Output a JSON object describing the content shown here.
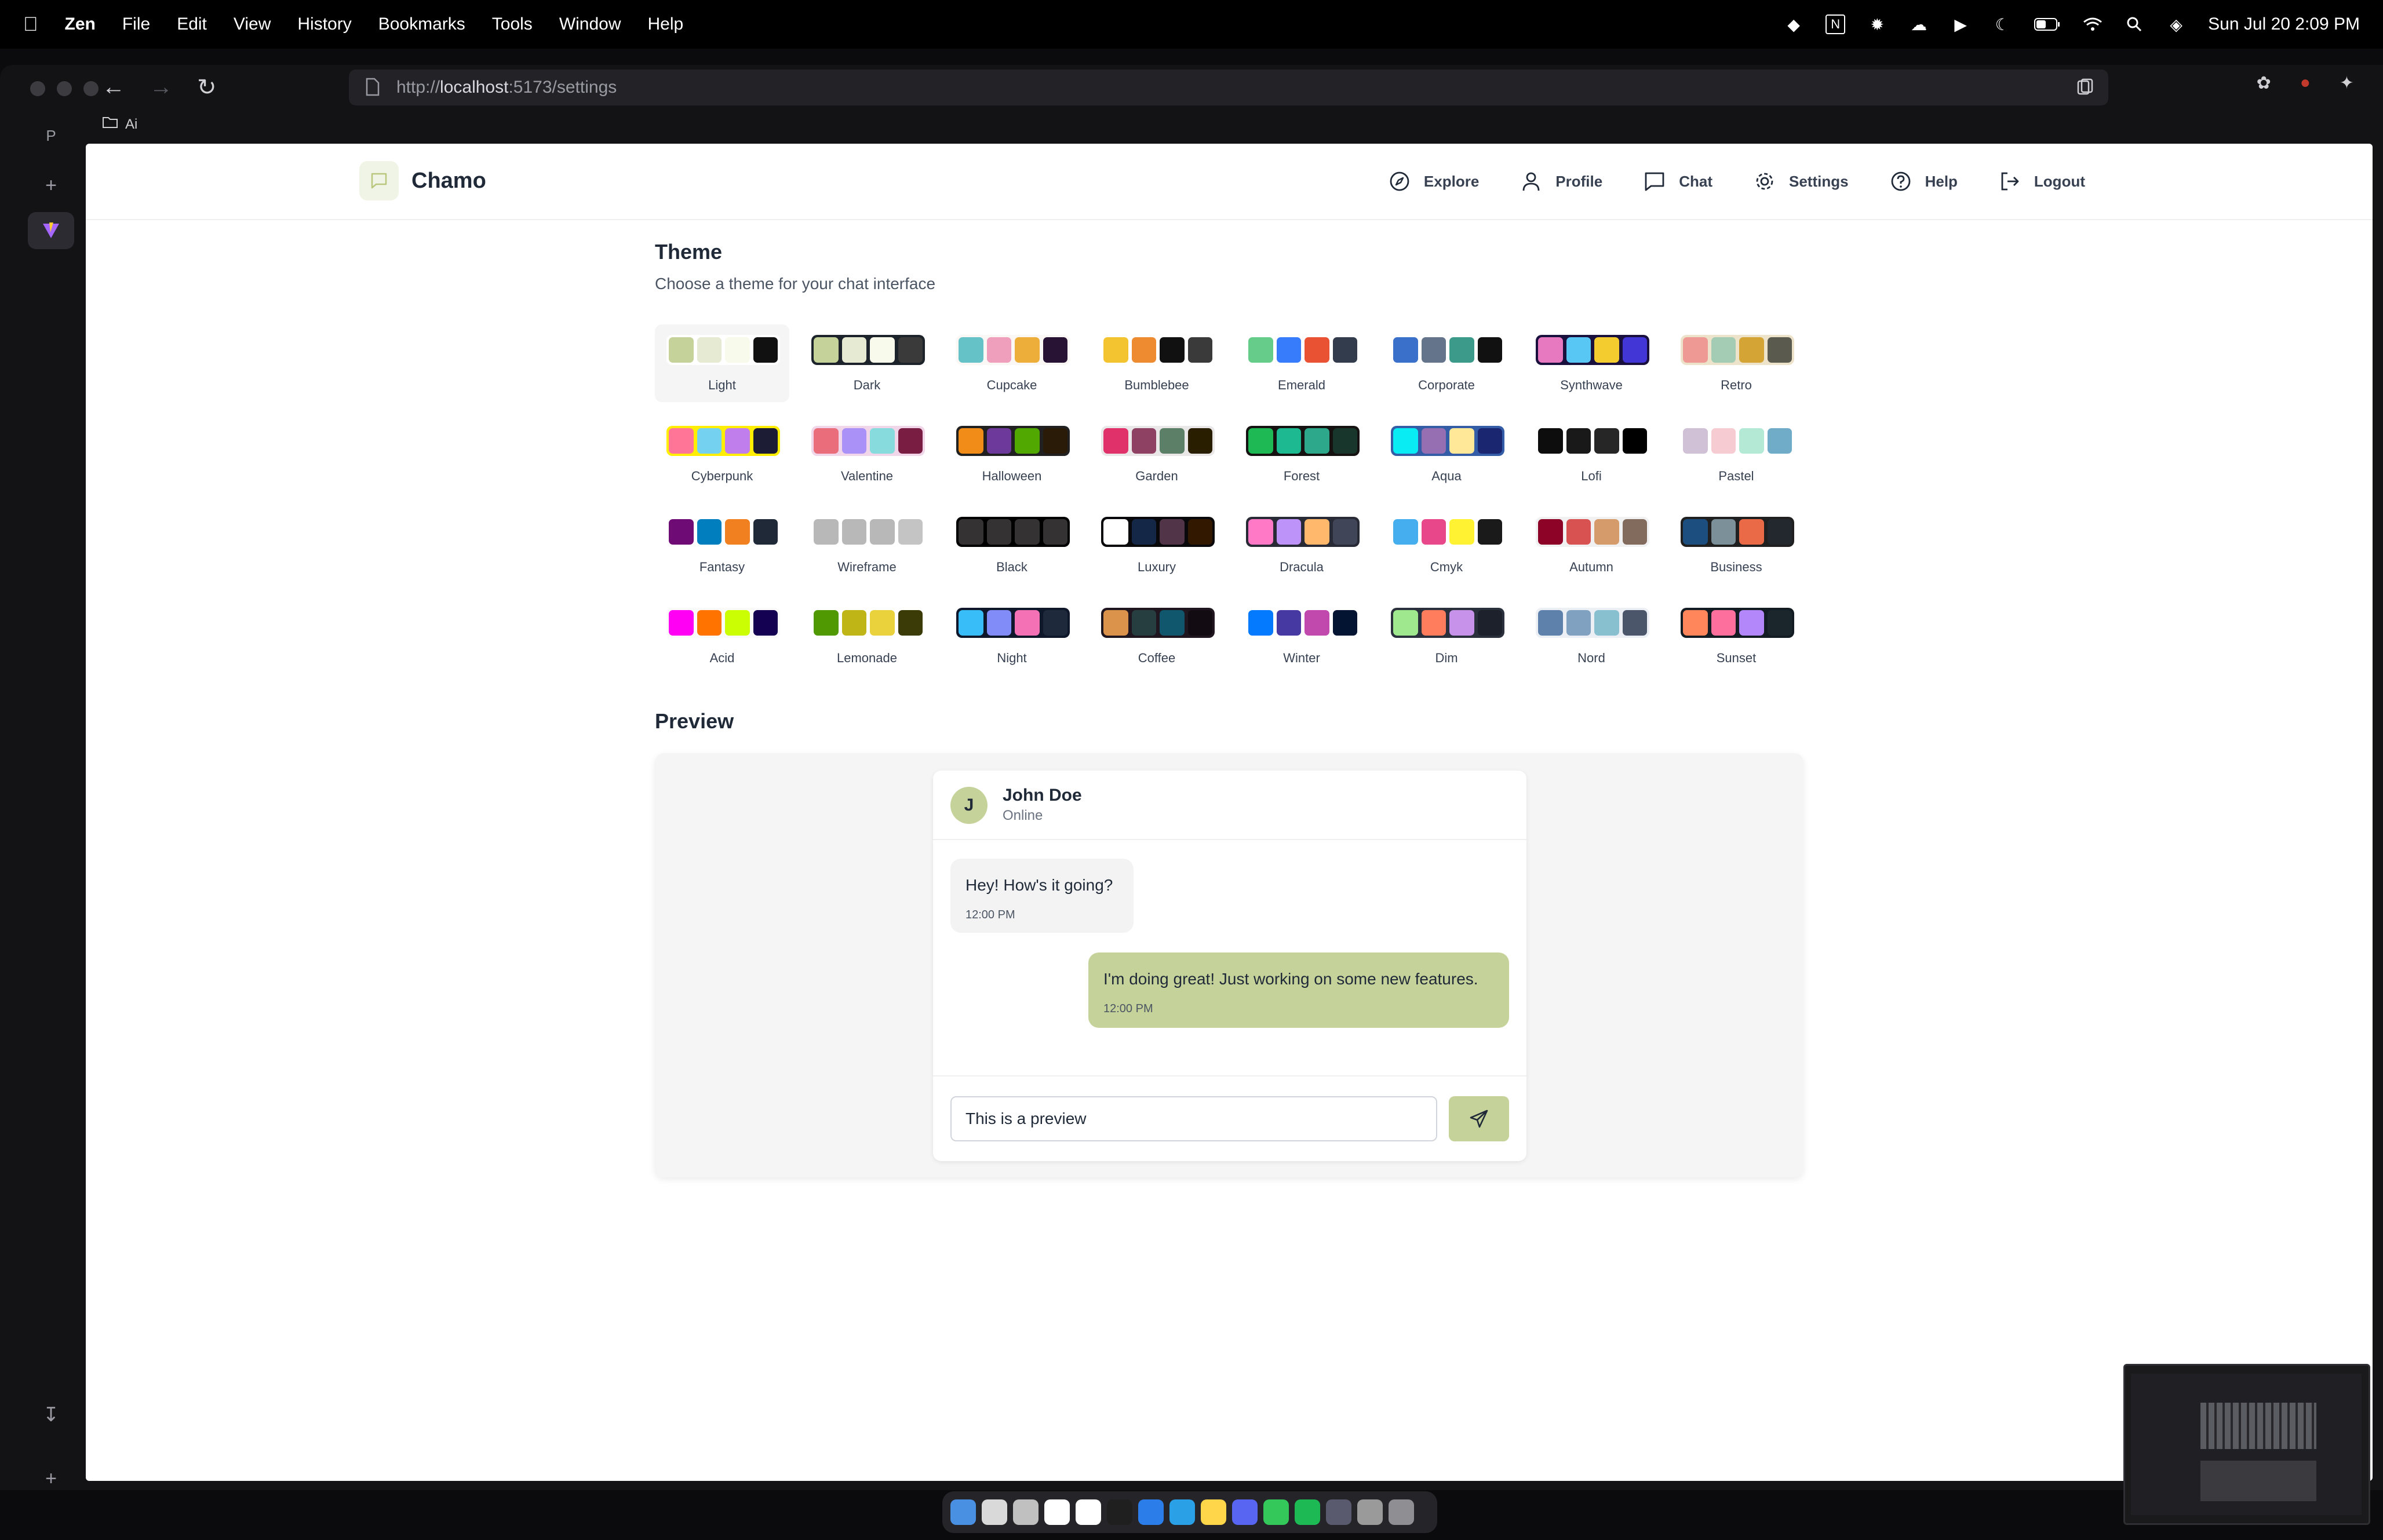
{
  "menubar": {
    "app": "Zen",
    "items": [
      "File",
      "Edit",
      "View",
      "History",
      "Bookmarks",
      "Tools",
      "Window",
      "Help"
    ],
    "clock": "Sun Jul 20  2:09 PM"
  },
  "browser": {
    "url_prefix": "http://",
    "url_host": "localhost",
    "url_path": ":5173/settings",
    "bookmark_folder": "Ai",
    "workspace_letter": "P"
  },
  "app": {
    "brand": "Chamo",
    "nav": [
      {
        "label": "Explore",
        "icon": "compass-icon"
      },
      {
        "label": "Profile",
        "icon": "user-icon"
      },
      {
        "label": "Chat",
        "icon": "chat-bubble-icon"
      },
      {
        "label": "Settings",
        "icon": "gear-icon"
      },
      {
        "label": "Help",
        "icon": "help-circle-icon"
      },
      {
        "label": "Logout",
        "icon": "logout-icon"
      }
    ]
  },
  "theme_section": {
    "title": "Theme",
    "subtitle": "Choose a theme for your chat interface",
    "selected": "Light",
    "themes": [
      {
        "name": "Light",
        "frame": "#ffffff",
        "colors": [
          "#c5d29a",
          "#e6ead3",
          "#f8fbec",
          "#111111"
        ]
      },
      {
        "name": "Dark",
        "frame": "#1d232a",
        "colors": [
          "#c5d29a",
          "#e6ead3",
          "#f8fbec",
          "#3a3a3a"
        ]
      },
      {
        "name": "Cupcake",
        "frame": "#faf7f5",
        "colors": [
          "#65c3c8",
          "#ef9fbc",
          "#eeaf3a",
          "#291334"
        ]
      },
      {
        "name": "Bumblebee",
        "frame": "#ffffff",
        "colors": [
          "#f4c430",
          "#ee8a2f",
          "#111111",
          "#3a3a3a"
        ]
      },
      {
        "name": "Emerald",
        "frame": "#ffffff",
        "colors": [
          "#66cc8a",
          "#377cfb",
          "#ea5234",
          "#333c4d"
        ]
      },
      {
        "name": "Corporate",
        "frame": "#ffffff",
        "colors": [
          "#3a70c9",
          "#64748b",
          "#3b9a8a",
          "#111111"
        ]
      },
      {
        "name": "Synthwave",
        "frame": "#1a103d",
        "colors": [
          "#e779c1",
          "#58c7f3",
          "#f3cc30",
          "#4336d6"
        ]
      },
      {
        "name": "Retro",
        "frame": "#ece3ca",
        "colors": [
          "#ef9995",
          "#a4cbb4",
          "#d4a535",
          "#5b5a4f"
        ]
      },
      {
        "name": "Cyberpunk",
        "frame": "#ffee00",
        "colors": [
          "#ff7598",
          "#75d1f0",
          "#c07eec",
          "#1c1d35"
        ]
      },
      {
        "name": "Valentine",
        "frame": "#f0d6e8",
        "colors": [
          "#e96d7b",
          "#a991f7",
          "#88dbdd",
          "#7a1d42"
        ]
      },
      {
        "name": "Halloween",
        "frame": "#212121",
        "colors": [
          "#f28c18",
          "#6d3a9c",
          "#51a800",
          "#2a1a08"
        ]
      },
      {
        "name": "Garden",
        "frame": "#e9e7e7",
        "colors": [
          "#e0316a",
          "#8e4162",
          "#5c7f67",
          "#291e00"
        ]
      },
      {
        "name": "Forest",
        "frame": "#171212",
        "colors": [
          "#1eb854",
          "#1db990",
          "#2ea88a",
          "#19362d"
        ]
      },
      {
        "name": "Aqua",
        "frame": "#345da7",
        "colors": [
          "#09ecf3",
          "#966fb3",
          "#ffe999",
          "#1b2670"
        ]
      },
      {
        "name": "Lofi",
        "frame": "#ffffff",
        "colors": [
          "#0d0d0d",
          "#1a1919",
          "#262626",
          "#000000"
        ]
      },
      {
        "name": "Pastel",
        "frame": "#ffffff",
        "colors": [
          "#d1c1d7",
          "#f6cbd1",
          "#b4e9d6",
          "#70acc7"
        ]
      },
      {
        "name": "Fantasy",
        "frame": "#ffffff",
        "colors": [
          "#6e0b75",
          "#007ebd",
          "#f18021",
          "#1f2937"
        ]
      },
      {
        "name": "Wireframe",
        "frame": "#ffffff",
        "colors": [
          "#b8b8b8",
          "#b8b8b8",
          "#b8b8b8",
          "#c4c4c4"
        ]
      },
      {
        "name": "Black",
        "frame": "#000000",
        "colors": [
          "#343232",
          "#343232",
          "#343232",
          "#343232"
        ]
      },
      {
        "name": "Luxury",
        "frame": "#09090b",
        "colors": [
          "#ffffff",
          "#152747",
          "#513448",
          "#331800"
        ]
      },
      {
        "name": "Dracula",
        "frame": "#282a36",
        "colors": [
          "#ff79c6",
          "#bd93f9",
          "#ffb86c",
          "#414558"
        ]
      },
      {
        "name": "Cmyk",
        "frame": "#ffffff",
        "colors": [
          "#45aeee",
          "#e8488a",
          "#fff232",
          "#1a1a1a"
        ]
      },
      {
        "name": "Autumn",
        "frame": "#f1f1f1",
        "colors": [
          "#8c0327",
          "#d85251",
          "#d59b6a",
          "#826a5c"
        ]
      },
      {
        "name": "Business",
        "frame": "#202020",
        "colors": [
          "#1c4e80",
          "#7c909a",
          "#ea6947",
          "#23282e"
        ]
      },
      {
        "name": "Acid",
        "frame": "#fafafa",
        "colors": [
          "#ff00f4",
          "#ff7400",
          "#cbfd03",
          "#140152"
        ]
      },
      {
        "name": "Lemonade",
        "frame": "#ffffff",
        "colors": [
          "#519903",
          "#c0b516",
          "#e9d23b",
          "#3a3b06"
        ]
      },
      {
        "name": "Night",
        "frame": "#0f172a",
        "colors": [
          "#38bdf8",
          "#818cf8",
          "#f471b5",
          "#1e293b"
        ]
      },
      {
        "name": "Coffee",
        "frame": "#20161f",
        "colors": [
          "#db924b",
          "#263e3f",
          "#10576d",
          "#120c12"
        ]
      },
      {
        "name": "Winter",
        "frame": "#ffffff",
        "colors": [
          "#047aff",
          "#463aa2",
          "#c148ac",
          "#021431"
        ]
      },
      {
        "name": "Dim",
        "frame": "#2a303c",
        "colors": [
          "#9fe88d",
          "#ff7d5c",
          "#c792e9",
          "#1c212b"
        ]
      },
      {
        "name": "Nord",
        "frame": "#eceff4",
        "colors": [
          "#5e81ac",
          "#81a1c1",
          "#88c0d0",
          "#4c566a"
        ]
      },
      {
        "name": "Sunset",
        "frame": "#121c22",
        "colors": [
          "#ff865b",
          "#fd6f9c",
          "#b387fa",
          "#1b262c"
        ]
      }
    ]
  },
  "preview_section": {
    "title": "Preview",
    "contact": {
      "initial": "J",
      "name": "John Doe",
      "status": "Online"
    },
    "messages": [
      {
        "text": "Hey! How's it going?",
        "time": "12:00 PM",
        "from": "them"
      },
      {
        "text": "I'm doing great! Just working on some new features.",
        "time": "12:00 PM",
        "from": "me"
      }
    ],
    "input_value": "This is a preview"
  },
  "colors": {
    "accent": "#c5d29a",
    "accent_light": "#f0f4e6"
  },
  "dock": {
    "app_colors": [
      "#4a90e2",
      "#d9d9d9",
      "#c0c0c0",
      "#ffffff",
      "#ffffff",
      "#1f1f1f",
      "#2b7de9",
      "#2aa1e6",
      "#ffd54a",
      "#5865f2",
      "#34c759",
      "#1db954",
      "#5a5a6e",
      "#9a9a9a",
      "#8e8e93"
    ]
  }
}
